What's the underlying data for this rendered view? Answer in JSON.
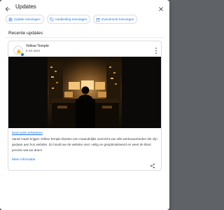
{
  "header": {
    "title": "Updates",
    "back_icon": "arrow-back-icon",
    "close_icon": "close-icon"
  },
  "chips": [
    {
      "label": "Update toevoegen",
      "icon": "post-add-icon"
    },
    {
      "label": "Aanbieding toevoegen",
      "icon": "offer-tag-icon"
    },
    {
      "label": "Evenement toevoegen",
      "icon": "event-calendar-icon"
    }
  ],
  "section": {
    "title": "Recente updates"
  },
  "post": {
    "business_name": "Yellow Temple",
    "date": "6 mrt 2024",
    "link_text": "Deze post verbeteren",
    "body": "Vanaf maart krijgen Yellow Temple klanten een maandelijks overzicht van alle werkzaamheden die zijn gedaan aan hun website. Zo houdt we de website snel, veilig en geoptimaliseerd en weet de klant precies wat we doen!",
    "more_info_label": "Meer informatie",
    "more_icon": "more-vert-icon",
    "share_icon": "share-icon",
    "image_subject": "person-at-computer-desk-image"
  },
  "colors": {
    "accent": "#1a73e8",
    "text": "#202124",
    "secondary_text": "#5f6368",
    "border": "#dadce0"
  }
}
